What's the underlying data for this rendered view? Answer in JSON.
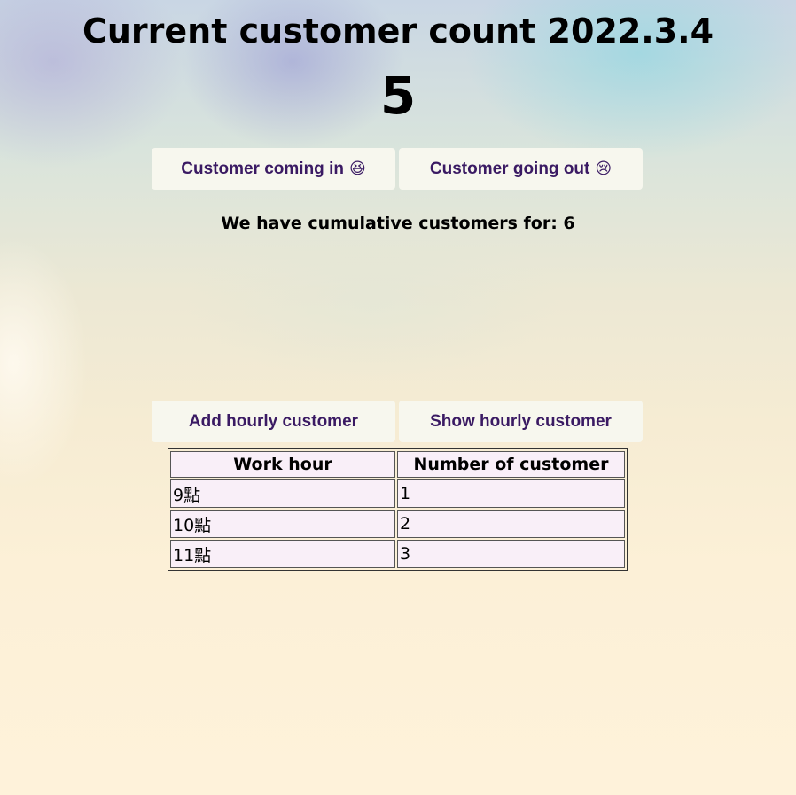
{
  "header": {
    "title": "Current customer count 2022.3.4",
    "current_count": "5"
  },
  "counter_buttons": {
    "coming_in_label": "Customer coming in",
    "coming_in_emoji": "😆",
    "going_out_label": "Customer going out",
    "going_out_emoji": "😢"
  },
  "cumulative": {
    "text": "We have cumulative customers for: 6"
  },
  "hourly_buttons": {
    "add_label": "Add hourly customer",
    "show_label": "Show hourly customer"
  },
  "hourly_table": {
    "headers": [
      "Work hour",
      "Number of customer"
    ],
    "rows": [
      {
        "hour": "9點",
        "count": "1"
      },
      {
        "hour": "10點",
        "count": "2"
      },
      {
        "hour": "11點",
        "count": "3"
      }
    ]
  },
  "colors": {
    "button_text": "#3a1a63",
    "button_bg": "#f7f7ee",
    "table_cell_bg": "#f9eff8"
  }
}
